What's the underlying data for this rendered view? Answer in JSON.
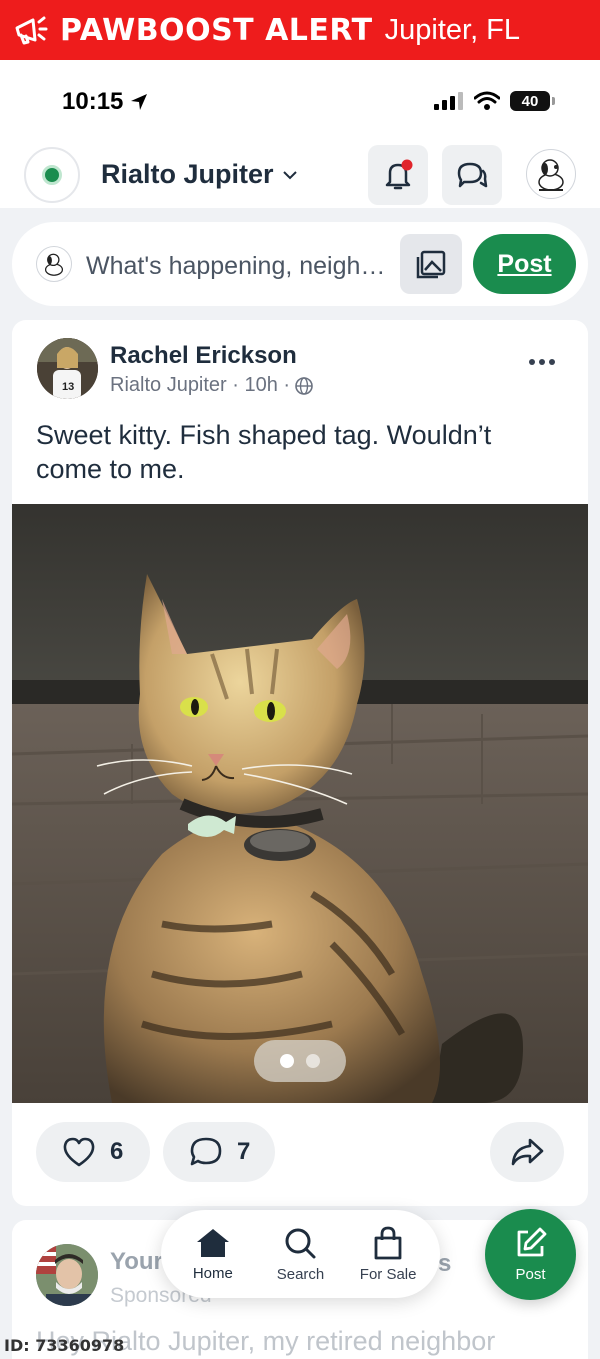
{
  "banner": {
    "brand": "PAWBOOST ALERT",
    "location": "Jupiter, FL",
    "icon": "megaphone-icon"
  },
  "status_bar": {
    "time": "10:15",
    "battery": "40"
  },
  "header": {
    "neighborhood": "Rialto Jupiter"
  },
  "composer": {
    "placeholder": "What's happening, neighbor?",
    "post_label": "Post"
  },
  "post": {
    "author": "Rachel Erickson",
    "meta": "Rialto Jupiter · 10h ·",
    "text": "Sweet kitty. Fish shaped tag. Wouldn’t come to me.",
    "likes": "6",
    "comments": "7"
  },
  "next_post": {
    "name": "Your",
    "suffix": "s",
    "sponsored": "Sponsored",
    "text": "Hey Rialto Jupiter, my retired neighbor"
  },
  "bottom_nav": {
    "home": "Home",
    "search": "Search",
    "for_sale": "For Sale"
  },
  "fab": {
    "label": "Post"
  },
  "footer": {
    "id": "ID: 73360978"
  },
  "colors": {
    "banner_red": "#ee1c1c",
    "accent_green": "#1a8c4e",
    "notification_red": "#e0242b"
  }
}
